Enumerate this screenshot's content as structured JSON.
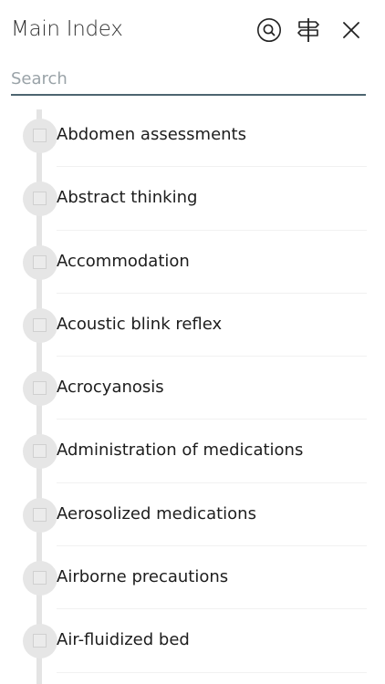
{
  "header": {
    "title": "Main Index",
    "icons": {
      "search": "search-icon",
      "signpost": "signpost-icon",
      "close": "close-icon"
    }
  },
  "search": {
    "placeholder": "Search",
    "value": ""
  },
  "index": {
    "items": [
      {
        "label": "Abdomen assessments",
        "checked": false
      },
      {
        "label": "Abstract thinking",
        "checked": false
      },
      {
        "label": "Accommodation",
        "checked": false
      },
      {
        "label": "Acoustic blink reflex",
        "checked": false
      },
      {
        "label": "Acrocyanosis",
        "checked": false
      },
      {
        "label": "Administration of medications",
        "checked": false
      },
      {
        "label": "Aerosolized medications",
        "checked": false
      },
      {
        "label": "Airborne precautions",
        "checked": false
      },
      {
        "label": "Air-fluidized bed",
        "checked": false
      }
    ]
  },
  "colors": {
    "search_underline": "#4d6570",
    "timeline": "#e4e4e4",
    "node": "#e6e6e6"
  }
}
